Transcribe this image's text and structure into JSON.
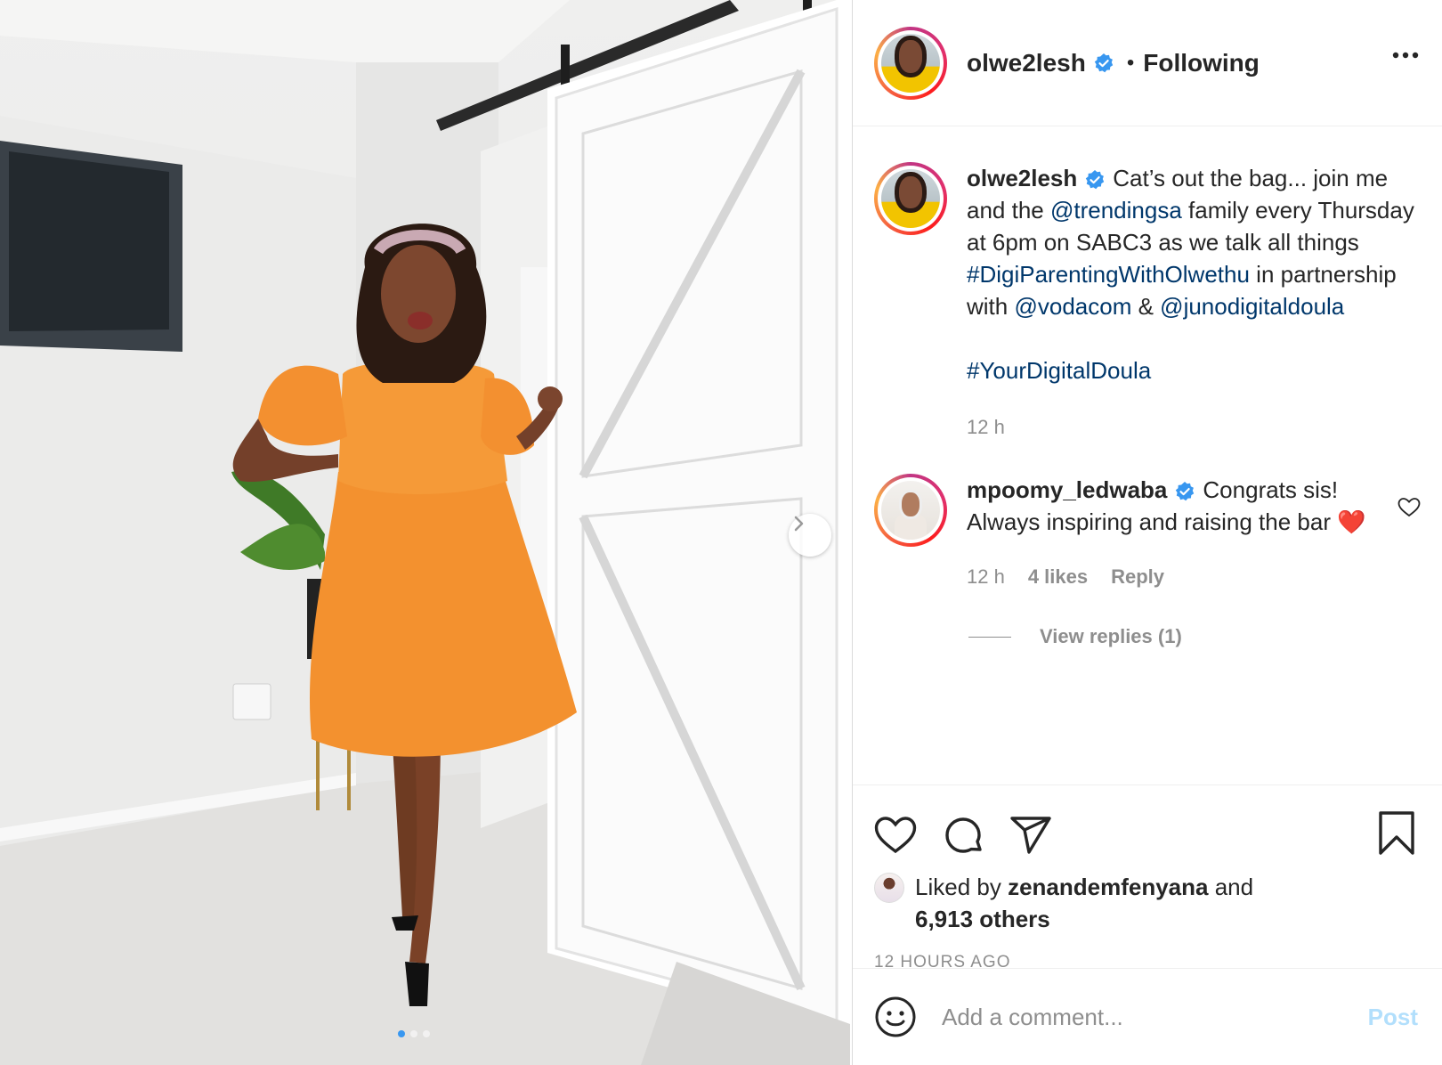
{
  "post": {
    "author": "olwe2lesh",
    "follow_status": "Following",
    "bullet": "•",
    "carousel": {
      "slide_count": 3,
      "active_index": 0
    }
  },
  "caption": {
    "username": "olwe2lesh",
    "text_1": "Cat’s out the bag... join me and the ",
    "mention_1": "@trendingsa",
    "text_2": " family every Thursday at 6pm on SABC3 as we talk all things ",
    "hashtag_1": "#DigiParentingWithOlwethu",
    "text_3": " in partnership with ",
    "mention_2": "@vodacom",
    "text_4": " & ",
    "mention_3": "@junodigitaldoula",
    "hashtag_2": "#YourDigitalDoula",
    "time": "12 h"
  },
  "comment": {
    "username": "mpoomy_ledwaba",
    "text": "Congrats sis! Always inspiring and raising the bar ",
    "emoji": "❤️",
    "time": "12 h",
    "likes": "4 likes",
    "reply_label": "Reply",
    "view_replies": "View replies (1)"
  },
  "likes": {
    "prefix": "Liked by ",
    "user": "zenandemfenyana",
    "middle": " and",
    "others": "6,913 others"
  },
  "timestamp": "12 HOURS AGO",
  "add_comment": {
    "placeholder": "Add a comment...",
    "post_label": "Post"
  },
  "colors": {
    "link": "#00376b",
    "verified": "#3897f0",
    "post_disabled": "#b2dffc",
    "dress": "#f3912f"
  },
  "icons": [
    "more-icon",
    "verified-icon",
    "heart-icon",
    "comment-icon",
    "share-icon",
    "bookmark-icon",
    "emoji-icon",
    "chevron-right-icon"
  ]
}
